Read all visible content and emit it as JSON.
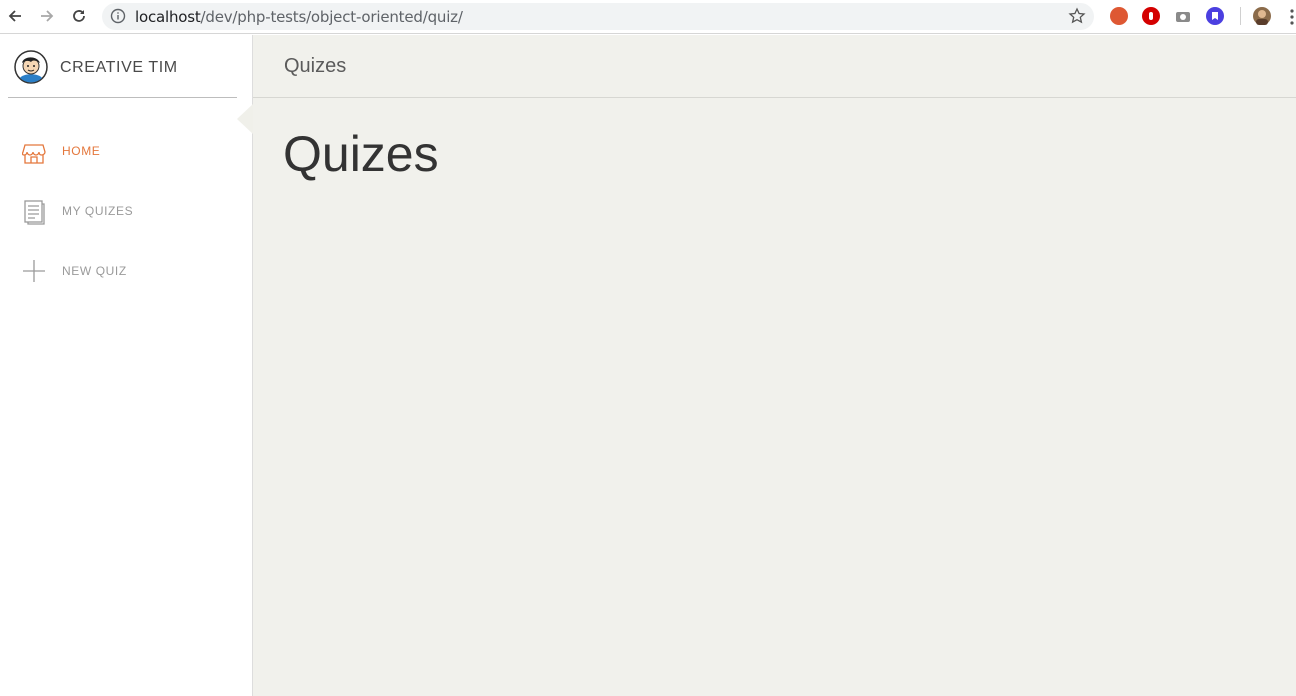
{
  "browser": {
    "url_host": "localhost",
    "url_path": "/dev/php-tests/object-oriented/quiz/",
    "icons": [
      "back-arrow-icon",
      "forward-arrow-icon",
      "reload-icon",
      "info-icon",
      "bookmark-star-icon"
    ]
  },
  "sidebar": {
    "brand": "CREATIVE TIM",
    "items": [
      {
        "label": "HOME",
        "icon": "store-icon",
        "active": true
      },
      {
        "label": "MY QUIZES",
        "icon": "document-icon",
        "active": false
      },
      {
        "label": "NEW QUIZ",
        "icon": "plus-icon",
        "active": false
      }
    ]
  },
  "main": {
    "navbar_title": "Quizes",
    "heading": "Quizes"
  },
  "colors": {
    "accent": "#e4773c",
    "main_bg": "#f1f1ec",
    "sidebar_bg": "#ffffff"
  }
}
